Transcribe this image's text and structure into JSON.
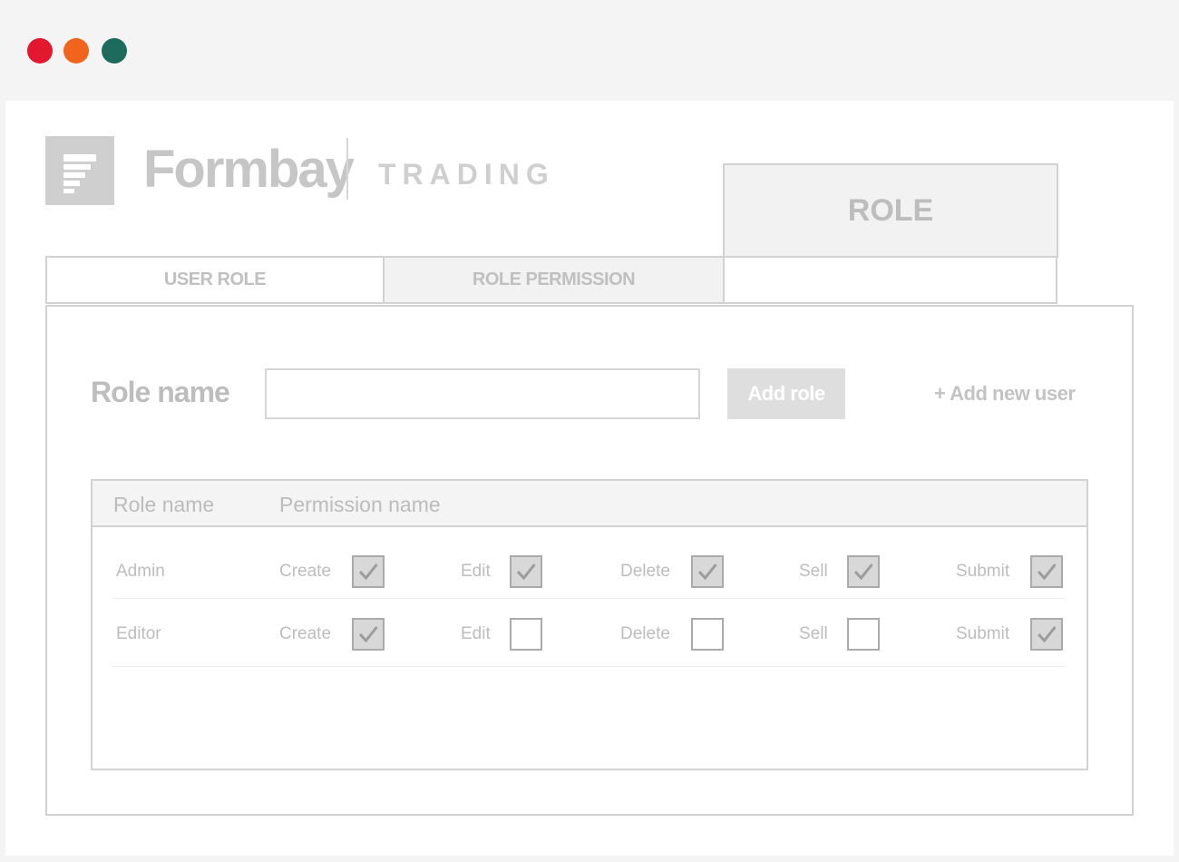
{
  "window": {
    "controls": [
      "close",
      "minimize",
      "maximize"
    ]
  },
  "brand": {
    "name": "Formbay",
    "suffix": "TRADING"
  },
  "header": {
    "title": "ROLE"
  },
  "tabs": [
    {
      "label": "USER ROLE"
    },
    {
      "label": "ROLE PERMISSION"
    }
  ],
  "form": {
    "role_name_label": "Role name",
    "role_name_value": "",
    "add_role_label": "Add role",
    "add_new_user_label": "+ Add new user"
  },
  "table": {
    "columns": [
      "Role name",
      "Permission name"
    ],
    "rows": [
      {
        "role": "Admin",
        "permissions": [
          {
            "label": "Create",
            "checked": true
          },
          {
            "label": "Edit",
            "checked": true
          },
          {
            "label": "Delete",
            "checked": true
          },
          {
            "label": "Sell",
            "checked": true
          },
          {
            "label": "Submit",
            "checked": true
          }
        ]
      },
      {
        "role": "Editor",
        "permissions": [
          {
            "label": "Create",
            "checked": true
          },
          {
            "label": "Edit",
            "checked": false
          },
          {
            "label": "Delete",
            "checked": false
          },
          {
            "label": "Sell",
            "checked": false
          },
          {
            "label": "Submit",
            "checked": true
          }
        ]
      }
    ]
  },
  "colors": {
    "close": "#e3172f",
    "minimize": "#f0641e",
    "maximize": "#1c6b5c"
  }
}
